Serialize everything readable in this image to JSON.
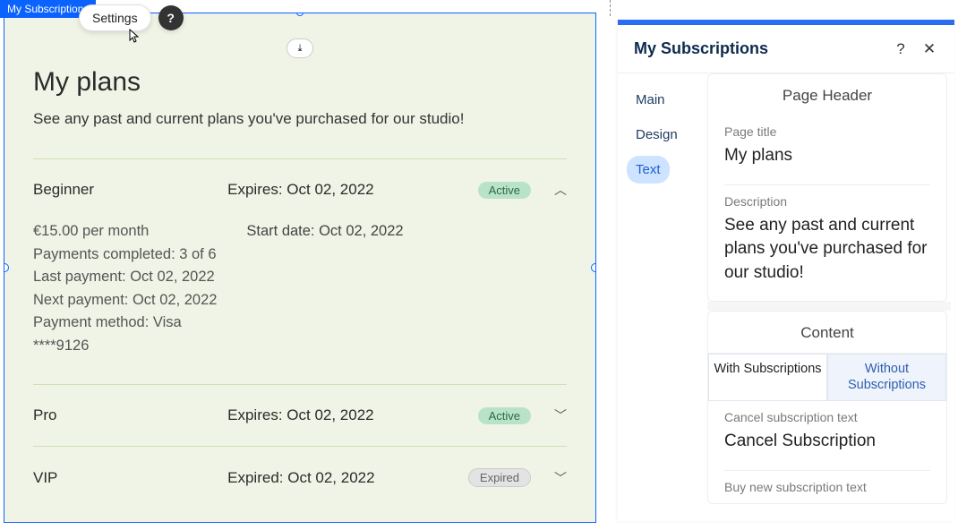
{
  "editor": {
    "element_tag": "My Subscriptions",
    "settings_label": "Settings",
    "help_glyph": "?",
    "download_glyph": "⤓"
  },
  "plans_page": {
    "title": "My plans",
    "description": "See any past and current plans you've purchased for our studio!",
    "plans": [
      {
        "name": "Beginner",
        "expire_label": "Expires: Oct 02, 2022",
        "status": "Active",
        "status_kind": "active",
        "expanded": true,
        "start_date": "Start date: Oct 02, 2022",
        "details": [
          "€15.00 per month",
          "Payments completed: 3 of 6",
          "Last payment: Oct 02, 2022",
          "Next payment: Oct 02, 2022",
          "Payment method: Visa",
          "****9126"
        ]
      },
      {
        "name": "Pro",
        "expire_label": "Expires: Oct 02, 2022",
        "status": "Active",
        "status_kind": "active",
        "expanded": false
      },
      {
        "name": "VIP",
        "expire_label": "Expired: Oct 02, 2022",
        "status": "Expired",
        "status_kind": "expired",
        "expanded": false
      }
    ]
  },
  "settings_panel": {
    "title": "My Subscriptions",
    "help_glyph": "?",
    "close_glyph": "✕",
    "tabs": {
      "main": "Main",
      "design": "Design",
      "text": "Text",
      "active": "text"
    },
    "sections": {
      "page_header": {
        "label": "Page Header",
        "page_title_label": "Page title",
        "page_title_value": "My plans",
        "description_label": "Description",
        "description_value": "See any past and current plans you've purchased for our studio!"
      },
      "content": {
        "label": "Content",
        "tab_with": "With Subscriptions",
        "tab_without": "Without Subscriptions",
        "cancel_label": "Cancel subscription text",
        "cancel_value": "Cancel Subscription",
        "buy_label": "Buy new subscription text"
      }
    }
  }
}
